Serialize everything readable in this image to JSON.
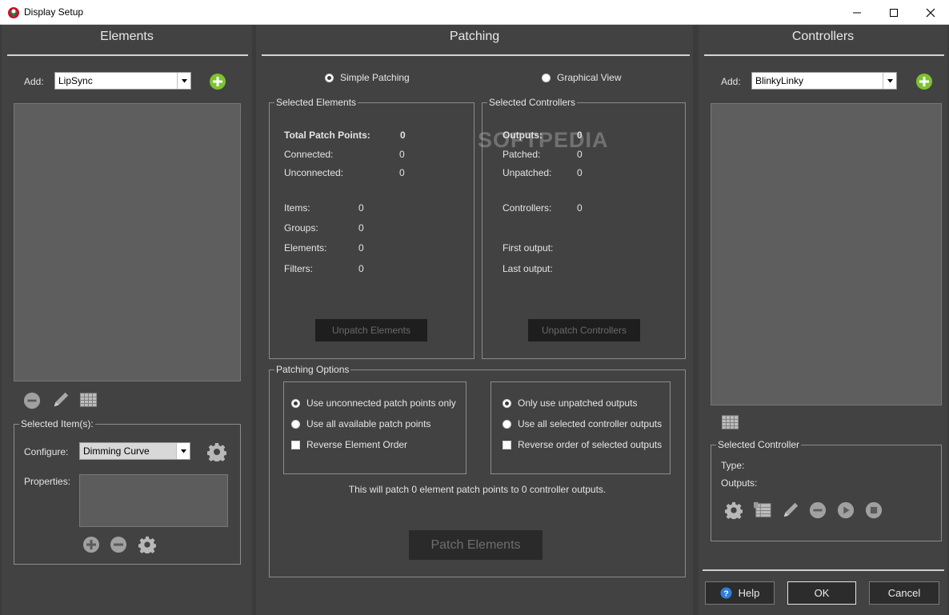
{
  "window": {
    "title": "Display Setup"
  },
  "watermark": "SOFTPEDIA",
  "elements": {
    "title": "Elements",
    "add_label": "Add:",
    "add_value": "LipSync",
    "selected_items_title": "Selected Item(s):",
    "configure_label": "Configure:",
    "configure_value": "Dimming Curve",
    "properties_label": "Properties:"
  },
  "patching": {
    "title": "Patching",
    "modes": [
      {
        "label": "Simple Patching",
        "selected": true
      },
      {
        "label": "Graphical View",
        "selected": false
      }
    ],
    "selected_elements": {
      "title": "Selected Elements",
      "total_label": "Total Patch Points:",
      "total_value": "0",
      "connected_label": "Connected:",
      "connected_value": "0",
      "unconnected_label": "Unconnected:",
      "unconnected_value": "0",
      "items_label": "Items:",
      "items_value": "0",
      "groups_label": "Groups:",
      "groups_value": "0",
      "elements_label": "Elements:",
      "elements_value": "0",
      "filters_label": "Filters:",
      "filters_value": "0",
      "button": "Unpatch Elements"
    },
    "selected_controllers": {
      "title": "Selected Controllers",
      "outputs_label": "Outputs:",
      "outputs_value": "0",
      "patched_label": "Patched:",
      "patched_value": "0",
      "unpatched_label": "Unpatched:",
      "unpatched_value": "0",
      "controllers_label": "Controllers:",
      "controllers_value": "0",
      "first_output_label": "First output:",
      "last_output_label": "Last output:",
      "button": "Unpatch Controllers"
    },
    "options": {
      "title": "Patching Options",
      "left": [
        {
          "label": "Use unconnected patch points only",
          "selected": true
        },
        {
          "label": "Use all available patch points",
          "selected": false
        }
      ],
      "reverse_elements": "Reverse Element Order",
      "right": [
        {
          "label": "Only use unpatched outputs",
          "selected": true
        },
        {
          "label": "Use all selected controller outputs",
          "selected": false
        }
      ],
      "reverse_outputs": "Reverse order of selected outputs",
      "summary": "This will patch 0 element patch points to 0 controller outputs.",
      "patch_button": "Patch Elements"
    }
  },
  "controllers": {
    "title": "Controllers",
    "add_label": "Add:",
    "add_value": "BlinkyLinky",
    "selected_controller_title": "Selected Controller",
    "type_label": "Type:",
    "outputs_label": "Outputs:"
  },
  "footer": {
    "help": "Help",
    "ok": "OK",
    "cancel": "Cancel"
  },
  "colors": {
    "accent_green": "#7dc232",
    "panel_bg": "#424242",
    "list_bg": "#5e5e5e",
    "help_blue": "#2f7fd8"
  }
}
